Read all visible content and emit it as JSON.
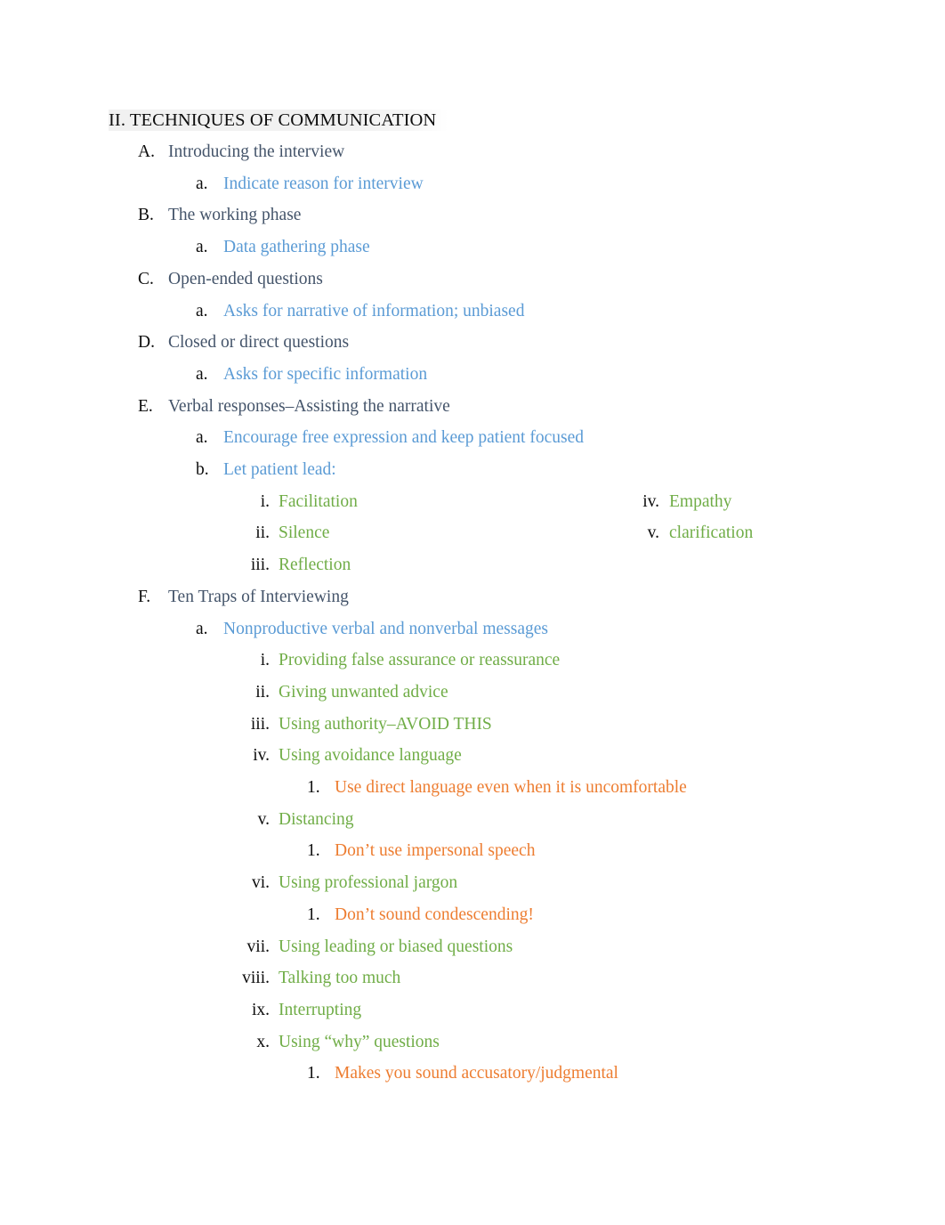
{
  "document": {
    "heading": {
      "label": "II.",
      "text": "II. TECHNIQUES OF COMMUNICATION"
    },
    "colors": {
      "heading": "#0d0d0d",
      "level_a": "#44546a",
      "level_lower_alpha": "#5b9bd5",
      "level_roman": "#70ad47",
      "level_number": "#ed7d31",
      "marker": "#0d0d0d",
      "page_background": "#ffffff"
    },
    "sections": [
      {
        "marker": "A.",
        "text": "Introducing the interview",
        "children": [
          {
            "marker": "a.",
            "text": "Indicate reason for interview"
          }
        ]
      },
      {
        "marker": "B.",
        "text": "The working phase",
        "children": [
          {
            "marker": "a.",
            "text": "Data gathering phase"
          }
        ]
      },
      {
        "marker": "C.",
        "text": "Open-ended questions",
        "children": [
          {
            "marker": "a.",
            "text": "Asks for narrative of information; unbiased"
          }
        ]
      },
      {
        "marker": "D.",
        "text": "Closed or direct questions",
        "children": [
          {
            "marker": "a.",
            "text": "Asks for specific information"
          }
        ]
      },
      {
        "marker": "E.",
        "text": "Verbal responses–Assisting the narrative",
        "children": [
          {
            "marker": "a.",
            "text": "Encourage free expression and keep patient focused"
          },
          {
            "marker": "b.",
            "text": "Let patient lead:"
          }
        ]
      },
      {
        "marker": "F.",
        "text": "Ten Traps of Interviewing",
        "children": [
          {
            "marker": "a.",
            "text": "Nonproductive verbal and nonverbal messages"
          }
        ]
      }
    ],
    "let_patient_lead": {
      "column_left": [
        {
          "marker": "i.",
          "text": "Facilitation"
        },
        {
          "marker": "ii.",
          "text": "Silence"
        },
        {
          "marker": "iii.",
          "text": "Reflection"
        }
      ],
      "column_right": [
        {
          "marker": "iv.",
          "text": "Empathy"
        },
        {
          "marker": "v.",
          "text": "clarification"
        }
      ]
    },
    "ten_traps": [
      {
        "marker": "i.",
        "text": "Providing false assurance or reassurance",
        "subitems": []
      },
      {
        "marker": "ii.",
        "text": "Giving unwanted advice",
        "subitems": []
      },
      {
        "marker": "iii.",
        "text": "Using authority–AVOID THIS",
        "subitems": []
      },
      {
        "marker": "iv.",
        "text": "Using avoidance language",
        "subitems": [
          {
            "marker": "1.",
            "text": "Use direct language even when it is uncomfortable"
          }
        ]
      },
      {
        "marker": "v.",
        "text": "Distancing",
        "subitems": [
          {
            "marker": "1.",
            "text": "Don’t use impersonal speech"
          }
        ]
      },
      {
        "marker": "vi.",
        "text": "Using professional jargon",
        "subitems": [
          {
            "marker": "1.",
            "text": "Don’t sound condescending!"
          }
        ]
      },
      {
        "marker": "vii.",
        "text": "Using leading or biased questions",
        "subitems": []
      },
      {
        "marker": "viii.",
        "text": "Talking too much",
        "subitems": []
      },
      {
        "marker": "ix.",
        "text": "Interrupting",
        "subitems": []
      },
      {
        "marker": "x.",
        "text": "Using “why” questions",
        "subitems": [
          {
            "marker": "1.",
            "text": "Makes you sound accusatory/judgmental"
          }
        ]
      }
    ]
  }
}
